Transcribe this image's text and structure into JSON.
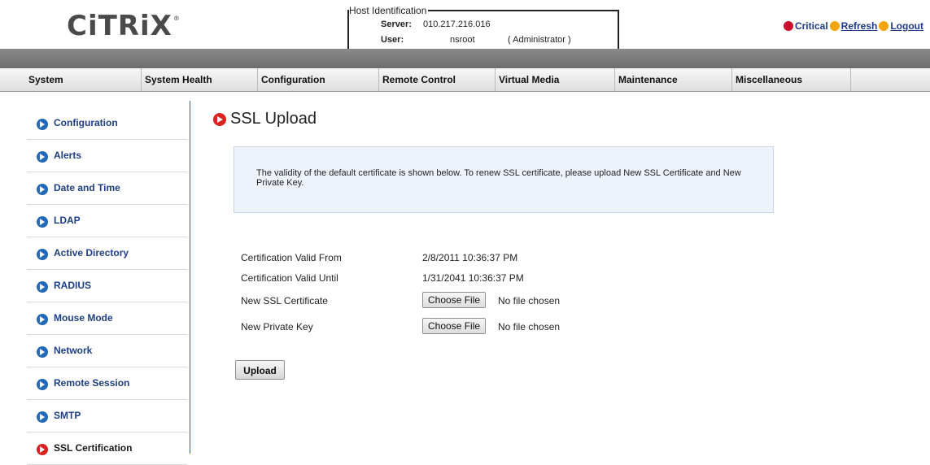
{
  "header": {
    "logo": "CiTRiX",
    "logo_mark": "®",
    "host_legend": "Host Identification",
    "server_label": "Server:",
    "server_value": "010.217.216.016",
    "user_label": "User:",
    "user_value": "nsroot",
    "role": "( Administrator )",
    "critical_label": "Critical",
    "refresh_label": "Refresh",
    "logout_label": "Logout"
  },
  "nav": {
    "items": [
      "System",
      "System Health",
      "Configuration",
      "Remote Control",
      "Virtual Media",
      "Maintenance",
      "Miscellaneous"
    ]
  },
  "sidebar": {
    "items": [
      {
        "label": "Configuration"
      },
      {
        "label": "Alerts"
      },
      {
        "label": "Date and Time"
      },
      {
        "label": "LDAP"
      },
      {
        "label": "Active Directory"
      },
      {
        "label": "RADIUS"
      },
      {
        "label": "Mouse Mode"
      },
      {
        "label": "Network"
      },
      {
        "label": "Remote Session"
      },
      {
        "label": "SMTP"
      },
      {
        "label": "SSL Certification"
      }
    ],
    "active_index": 10
  },
  "main": {
    "title": "SSL Upload",
    "info_text": "The validity of the default certificate is shown below. To renew SSL certificate, please upload New SSL Certificate and New Private Key.",
    "valid_from_label": "Certification Valid From",
    "valid_from_value": "2/8/2011 10:36:37 PM",
    "valid_until_label": "Certification Valid Until",
    "valid_until_value": "1/31/2041 10:36:37 PM",
    "new_cert_label": "New SSL Certificate",
    "new_key_label": "New Private Key",
    "choose_file_label": "Choose File",
    "no_file_text": "No file chosen",
    "upload_label": "Upload"
  },
  "colors": {
    "accent_blue": "#2469b5",
    "active_red": "#d9231f",
    "nav_dark": "#6d6d6d"
  }
}
